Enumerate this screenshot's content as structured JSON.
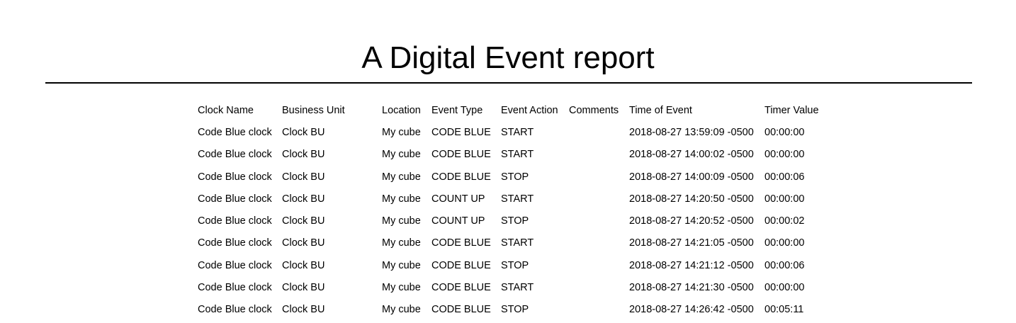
{
  "report": {
    "title": "A Digital Event report"
  },
  "table": {
    "headers": [
      "Clock Name",
      "Business Unit",
      "Location",
      "Event Type",
      "Event Action",
      "Comments",
      "Time of Event",
      "Timer Value"
    ],
    "rows": [
      [
        "Code Blue clock",
        "Clock BU",
        "My cube",
        "CODE BLUE",
        "START",
        "",
        "2018-08-27 13:59:09 -0500",
        "00:00:00"
      ],
      [
        "Code Blue clock",
        "Clock BU",
        "My cube",
        "CODE BLUE",
        "START",
        "",
        "2018-08-27 14:00:02 -0500",
        "00:00:00"
      ],
      [
        "Code Blue clock",
        "Clock BU",
        "My cube",
        "CODE BLUE",
        "STOP",
        "",
        "2018-08-27 14:00:09 -0500",
        "00:00:06"
      ],
      [
        "Code Blue clock",
        "Clock BU",
        "My cube",
        "COUNT UP",
        "START",
        "",
        "2018-08-27 14:20:50 -0500",
        "00:00:00"
      ],
      [
        "Code Blue clock",
        "Clock BU",
        "My cube",
        "COUNT UP",
        "STOP",
        "",
        "2018-08-27 14:20:52 -0500",
        "00:00:02"
      ],
      [
        "Code Blue clock",
        "Clock BU",
        "My cube",
        "CODE BLUE",
        "START",
        "",
        "2018-08-27 14:21:05 -0500",
        "00:00:00"
      ],
      [
        "Code Blue clock",
        "Clock BU",
        "My cube",
        "CODE BLUE",
        "STOP",
        "",
        "2018-08-27 14:21:12 -0500",
        "00:00:06"
      ],
      [
        "Code Blue clock",
        "Clock BU",
        "My cube",
        "CODE BLUE",
        "START",
        "",
        "2018-08-27 14:21:30 -0500",
        "00:00:00"
      ],
      [
        "Code Blue clock",
        "Clock BU",
        "My cube",
        "CODE BLUE",
        "STOP",
        "",
        "2018-08-27 14:26:42 -0500",
        "00:05:11"
      ]
    ]
  }
}
